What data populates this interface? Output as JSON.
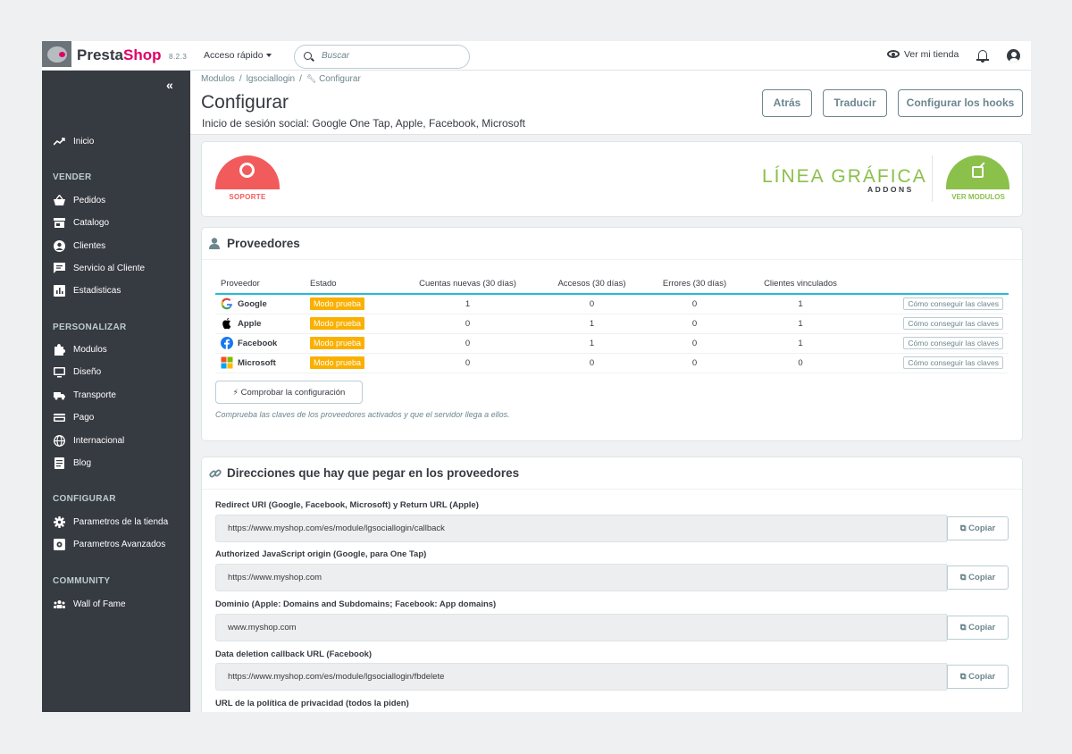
{
  "header": {
    "brand_part1": "Presta",
    "brand_part2": "Shop",
    "version": "8.2.3",
    "quick_access": "Acceso rápido",
    "search_placeholder": "Buscar",
    "view_shop": "Ver mi tienda"
  },
  "sidebar": {
    "collapse": "«",
    "items": {
      "inicio": "Inicio",
      "sec_vender": "VENDER",
      "pedidos": "Pedidos",
      "catalogo": "Catalogo",
      "clientes": "Clientes",
      "servicio": "Servicio al Cliente",
      "estadisticas": "Estadisticas",
      "sec_personalizar": "PERSONALIZAR",
      "modulos": "Modulos",
      "diseno": "Diseño",
      "transporte": "Transporte",
      "pago": "Pago",
      "internacional": "Internacional",
      "blog": "Blog",
      "sec_configurar": "CONFIGURAR",
      "parametros_tienda": "Parametros de la tienda",
      "parametros_avanzados": "Parametros Avanzados",
      "sec_community": "COMMUNITY",
      "wall": "Wall of Fame"
    }
  },
  "page": {
    "breadcrumb": [
      "Modulos",
      "lgsociallogin",
      "Configurar"
    ],
    "title": "Configurar",
    "subtitle": "Inicio de sesión social: Google One Tap, Apple, Facebook, Microsoft",
    "buttons": {
      "back": "Atrás",
      "translate": "Traducir",
      "hooks": "Configurar los hooks"
    }
  },
  "banner": {
    "support": "SOPORTE",
    "brand": "LÍNEA GRÁFICA",
    "brand_sub": "ADDONS",
    "view_modules": "VER MODULOS"
  },
  "providers": {
    "title": "Proveedores",
    "columns": [
      "Proveedor",
      "Estado",
      "Cuentas nuevas (30 días)",
      "Accesos (30 días)",
      "Errores (30 días)",
      "Clientes vinculados"
    ],
    "rows": [
      {
        "name": "Google",
        "status": "Modo prueba",
        "new": "1",
        "access": "0",
        "errors": "0",
        "linked": "1",
        "action": "Cómo conseguir las claves"
      },
      {
        "name": "Apple",
        "status": "Modo prueba",
        "new": "0",
        "access": "1",
        "errors": "0",
        "linked": "1",
        "action": "Cómo conseguir las claves"
      },
      {
        "name": "Facebook",
        "status": "Modo prueba",
        "new": "0",
        "access": "1",
        "errors": "0",
        "linked": "1",
        "action": "Cómo conseguir las claves"
      },
      {
        "name": "Microsoft",
        "status": "Modo prueba",
        "new": "0",
        "access": "0",
        "errors": "0",
        "linked": "0",
        "action": "Cómo conseguir las claves"
      }
    ],
    "check_button": "Comprobar la configuración",
    "check_note": "Comprueba las claves de los proveedores activados y que el servidor llega a ellos."
  },
  "urls": {
    "title": "Direcciones que hay que pegar en los proveedores",
    "copy_label": "Copiar",
    "items": [
      {
        "label": "Redirect URI (Google, Facebook, Microsoft) y Return URL (Apple)",
        "value": "https://www.myshop.com/es/module/lgsociallogin/callback"
      },
      {
        "label": "Authorized JavaScript origin (Google, para One Tap)",
        "value": "https://www.myshop.com"
      },
      {
        "label": "Dominio (Apple: Domains and Subdomains; Facebook: App domains)",
        "value": "www.myshop.com"
      },
      {
        "label": "Data deletion callback URL (Facebook)",
        "value": "https://www.myshop.com/es/module/lgsociallogin/fbdelete"
      },
      {
        "label": "URL de la política de privacidad (todos la piden)",
        "value": ""
      }
    ]
  }
}
